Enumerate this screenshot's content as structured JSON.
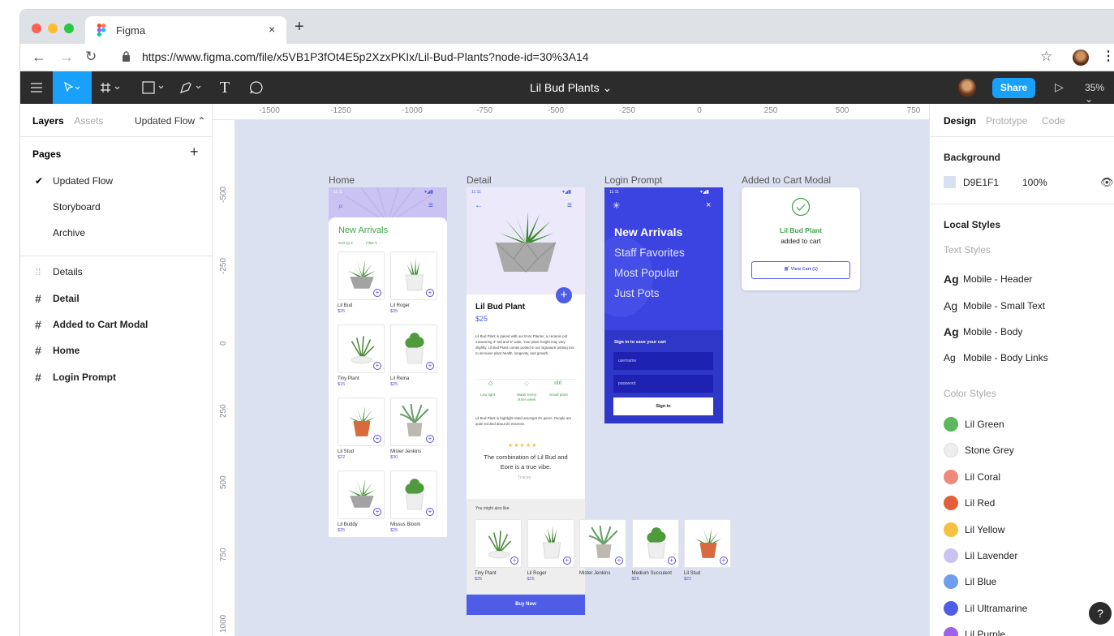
{
  "browser": {
    "tab_title": "Figma",
    "url": "https://www.figma.com/file/x5VB1P3fOt4E5p2XzxPKIx/Lil-Bud-Plants?node-id=30%3A14",
    "new_tab": "+",
    "close": "×"
  },
  "toolbar": {
    "doc_title": "Lil Bud Plants ⌄",
    "share": "Share",
    "zoom": "35% ⌄"
  },
  "left_panel": {
    "tabs": [
      "Layers",
      "Assets"
    ],
    "current_page": "Updated Flow ⌃",
    "pages_title": "Pages",
    "add": "+",
    "pages": [
      "Updated Flow",
      "Storyboard",
      "Archive"
    ],
    "layers": [
      {
        "icon": "dotted-frame",
        "name": "Details",
        "bold": false
      },
      {
        "icon": "frame",
        "name": "Detail",
        "bold": true
      },
      {
        "icon": "frame",
        "name": "Added to Cart Modal",
        "bold": true
      },
      {
        "icon": "frame",
        "name": "Home",
        "bold": true
      },
      {
        "icon": "frame",
        "name": "Login Prompt",
        "bold": true
      }
    ]
  },
  "canvas": {
    "ruler_top": [
      "-1500",
      "-1250",
      "-1000",
      "-750",
      "-500",
      "-250",
      "0",
      "250",
      "500",
      "750"
    ],
    "ruler_left": [
      "-500",
      "-250",
      "0",
      "250",
      "500",
      "750",
      "1000"
    ],
    "frames": {
      "home": {
        "label": "Home",
        "time": "11:11",
        "heading": "New Arrivals",
        "sort": "Sort by ▾",
        "filter": "Filter ▾",
        "products": [
          {
            "name": "Lil Bud",
            "price": "$25"
          },
          {
            "name": "Lil Roger",
            "price": "$35"
          },
          {
            "name": "Tiny Plant",
            "price": "$15"
          },
          {
            "name": "Lil Reina",
            "price": "$25"
          },
          {
            "name": "Lil Stud",
            "price": "$22"
          },
          {
            "name": "Mister Jenkins",
            "price": "$30"
          },
          {
            "name": "Lil Buddy",
            "price": "$25"
          },
          {
            "name": "Missus Bloom",
            "price": "$25"
          }
        ]
      },
      "detail": {
        "label": "Detail",
        "time": "11:11",
        "title": "Lil Bud Plant",
        "price": "$25",
        "description": "Lil Bud Plant is paired with our Eore Planter, a ceramic pot measuring 3\" tall and 5\" wide. Your plant height may vary slightly. Lil Bud Plant comes potted in our signature potting mix to increase plant health, longevity, and growth.",
        "features": [
          "Low light",
          "Water every other week",
          "Small plant"
        ],
        "review_intro": "Lil Bud Plant is highlight rated amongst it's peers. People are quite excited about its essense.",
        "stars": "★★★★★",
        "quote": "The combination of Lil Bud and Eore is a true vibe.",
        "author": "Tracey",
        "also_like": "You might also like",
        "suggestions": [
          {
            "name": "Tiny Plant",
            "price": "$25"
          },
          {
            "name": "Lil Roger",
            "price": "$25"
          },
          {
            "name": "Mister Jenkins",
            "price": ""
          },
          {
            "name": "Medium Succulent",
            "price": "$25"
          },
          {
            "name": "Lil Stud",
            "price": "$22"
          }
        ],
        "buy": "Buy Now"
      },
      "login": {
        "label": "Login Prompt",
        "time": "11:11",
        "menu": [
          "New Arrivals",
          "Staff Favorites",
          "Most Popular",
          "Just Pots"
        ],
        "sign_in_title": "Sign in to save your cart",
        "username": "username",
        "password": "password",
        "sign_in": "Sign in"
      },
      "modal": {
        "label": "Added to Cart Modal",
        "product": "Lil Bud Plant",
        "message": "added to cart",
        "button": "View Cart (1)"
      }
    }
  },
  "right_panel": {
    "tabs": [
      "Design",
      "Prototype",
      "Code"
    ],
    "background_title": "Background",
    "bg_hex": "D9E1F1",
    "bg_opacity": "100%",
    "local_styles": "Local Styles",
    "text_styles_title": "Text Styles",
    "text_styles": [
      {
        "ag": "Ag",
        "name": "Mobile - Header"
      },
      {
        "ag": "Ag",
        "name": "Mobile - Small Text"
      },
      {
        "ag": "Ag",
        "name": "Mobile - Body"
      },
      {
        "ag": "Ag",
        "name": "Mobile - Body Links"
      }
    ],
    "color_styles_title": "Color Styles",
    "color_styles": [
      {
        "name": "Lil Green",
        "color": "#5cb85c"
      },
      {
        "name": "Stone Grey",
        "color": "#ededed"
      },
      {
        "name": "Lil Coral",
        "color": "#ef8a7a"
      },
      {
        "name": "Lil Red",
        "color": "#e35f3a"
      },
      {
        "name": "Lil Yellow",
        "color": "#f6c142"
      },
      {
        "name": "Lil Lavender",
        "color": "#c9c2f2"
      },
      {
        "name": "Lil Blue",
        "color": "#6f9ef0"
      },
      {
        "name": "Lil Ultramarine",
        "color": "#4f5ce6"
      },
      {
        "name": "Lil Purple",
        "color": "#9b63e8"
      }
    ],
    "help": "?"
  }
}
